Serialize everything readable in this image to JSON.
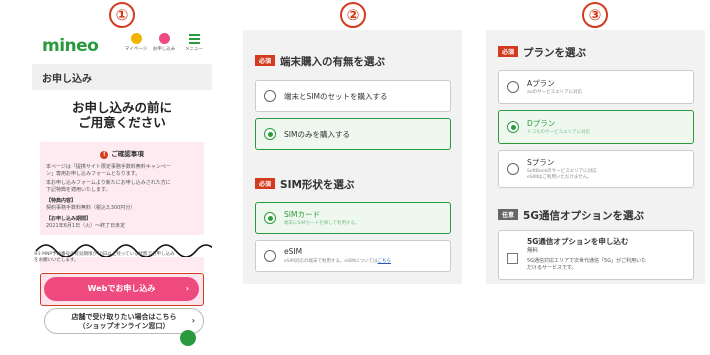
{
  "step_numbers": [
    "①",
    "②",
    "③"
  ],
  "panel1": {
    "logo": "mineo",
    "header_icons": [
      {
        "label": "マイページ",
        "icon": "person-icon",
        "color": "#f2b400"
      },
      {
        "label": "お申し込み",
        "icon": "cart-icon",
        "color": "#ef4a7f"
      },
      {
        "label": "メニュー",
        "icon": "menu-icon",
        "color": "#2a9a3c"
      }
    ],
    "band_title": "お申し込み",
    "page_title_line1": "お申し込みの前に",
    "page_title_line2": "ご用意ください",
    "notice_title": "ご確認事項",
    "notice_lines": [
      "本ページは「提携サイト限定事務手数料無料キャンペー",
      "ン」専用お申し込みフォームとなります。",
      "本お申し込みフォームより新たにお申し込みされた方に",
      "下記特典を適用いたします。"
    ],
    "benefit_heading": "【特典内容】",
    "benefit_text": "契約事務手数料無料（税込3,300円分）",
    "period_heading": "【お申し込み期間】",
    "period_text": "2021年6月1日（火）～終了日未定",
    "footnote": "※3 MNP予約番号の有効期限が10日以上残っている状態でお申し込み",
    "footnote2": "をお願いいたします。",
    "web_button": "Webでお申し込み",
    "shop_button_line1": "店舗で受け取りたい場合はこちら",
    "shop_button_line2": "（ショップオンライン窓口）",
    "chevron": "›"
  },
  "panel2": {
    "section1_tag": "必須",
    "section1_title": "端末購入の有無を選ぶ",
    "option1": "端末とSIMのセットを購入する",
    "option2": "SIMのみを購入する",
    "section2_tag": "必須",
    "section2_title": "SIM形状を選ぶ",
    "sim_card": "SIMカード",
    "sim_card_sub": "端末にSIMカードを挿して利用する。",
    "esim": "eSIM",
    "esim_sub": "eSIM対応の端末で利用する。eSIMについては",
    "esim_link": "こちら"
  },
  "panel3": {
    "section1_tag": "必須",
    "section1_title": "プランを選ぶ",
    "plan_a": "Aプラン",
    "plan_a_sub": "auのサービスエリアに対応",
    "plan_d": "Dプラン",
    "plan_d_sub": "ドコモのサービスエリアに対応",
    "plan_s": "Sプラン",
    "plan_s_sub1": "SoftBankのサービスエリアに対応",
    "plan_s_sub2": "eSIMはご利用いただけません。",
    "section2_tag": "任意",
    "section2_title": "5G通信オプションを選ぶ",
    "opt_5g": "5G通信オプションを申し込む",
    "opt_5g_free": "無料",
    "opt_5g_desc1": "5G通信対応エリアで次世代通信「5G」がご利用いた",
    "opt_5g_desc2": "だけるサービスです。"
  }
}
